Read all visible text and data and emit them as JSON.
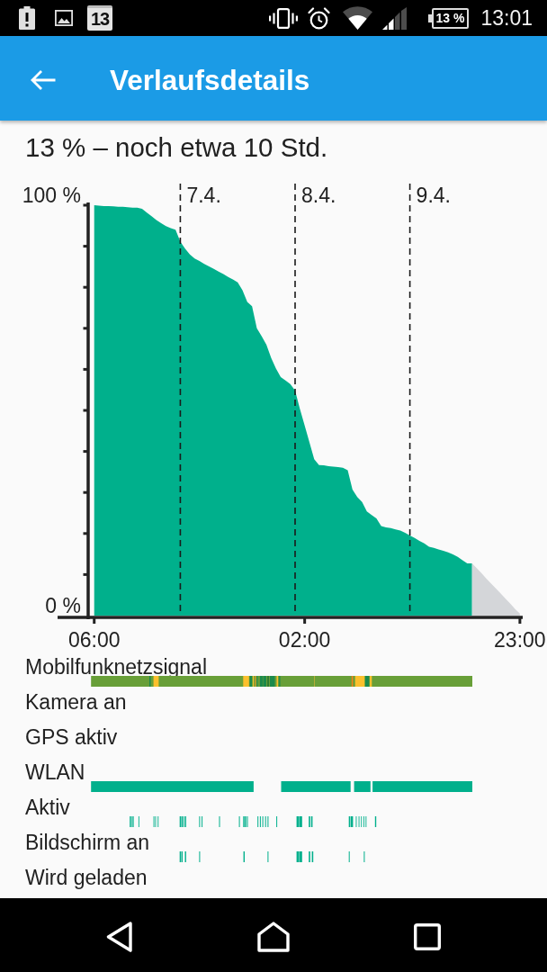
{
  "status_bar": {
    "calendar_day": "13",
    "battery": "13 %",
    "time": "13:01"
  },
  "app_bar": {
    "title": "Verlaufsdetails"
  },
  "summary": "13 % – noch etwa 10 Std.",
  "chart": {
    "day_labels": [
      "7.4.",
      "8.4.",
      "9.4."
    ],
    "chart_data": {
      "type": "area",
      "grid": true,
      "categories": [
        "06:00",
        null,
        null,
        null,
        null,
        null,
        null,
        null,
        null,
        null,
        null,
        null,
        null,
        null,
        null,
        null,
        null,
        null,
        null,
        null,
        null,
        null,
        null,
        null,
        null,
        null,
        null,
        null,
        null,
        null,
        null,
        null,
        null,
        null,
        null,
        null,
        null,
        null,
        null,
        null,
        null,
        null,
        null,
        null,
        "02:00",
        null,
        null,
        null,
        null,
        null,
        null,
        null,
        null,
        null,
        null,
        null,
        null,
        null,
        null,
        null,
        null,
        null,
        null,
        null,
        null,
        null,
        null,
        null,
        null,
        null,
        null,
        null,
        null,
        null,
        null,
        null,
        null,
        null,
        null,
        null,
        null,
        null,
        null,
        null,
        null,
        null,
        null,
        null,
        null,
        "23:00"
      ],
      "series": [
        {
          "color": "#00b08c",
          "values": [
            100.0,
            99.9,
            99.8,
            99.8,
            99.7,
            99.6,
            99.6,
            99.5,
            99.4,
            99.4,
            99.1,
            98.2,
            97.3,
            96.4,
            95.6,
            94.9,
            94.4,
            94.0,
            91.1,
            89.4,
            88.0,
            87.0,
            86.4,
            85.7,
            85.1,
            84.5,
            83.8,
            83.2,
            82.5,
            81.9,
            81.2,
            79.3,
            76.4,
            75.4,
            70.0,
            68.1,
            66.0,
            62.8,
            60.2,
            58.1,
            57.3,
            56.4,
            54.8,
            50.4,
            46.3,
            42.2,
            38.1,
            36.7,
            36.6,
            36.4,
            36.3,
            36.2,
            36.0,
            35.4,
            30.7,
            28.9,
            27.7,
            25.4,
            24.5,
            23.7,
            21.8,
            21.5,
            21.3,
            21.0,
            20.7,
            20.2,
            19.5,
            18.9,
            18.2,
            17.6,
            16.8,
            16.5,
            16.1,
            15.8,
            15.4,
            14.9,
            14.3,
            13.5,
            12.7,
            12.7,
            null,
            null,
            null,
            null,
            null,
            null,
            null,
            null,
            null,
            null
          ]
        },
        {
          "color": "#d4d6d9",
          "values": [
            null,
            null,
            null,
            null,
            null,
            null,
            null,
            null,
            null,
            null,
            null,
            null,
            null,
            null,
            null,
            null,
            null,
            null,
            null,
            null,
            null,
            null,
            null,
            null,
            null,
            null,
            null,
            null,
            null,
            null,
            null,
            null,
            null,
            null,
            null,
            null,
            null,
            null,
            null,
            null,
            null,
            null,
            null,
            null,
            null,
            null,
            null,
            null,
            null,
            null,
            null,
            null,
            null,
            null,
            null,
            null,
            null,
            null,
            null,
            null,
            null,
            null,
            null,
            null,
            null,
            null,
            null,
            null,
            null,
            null,
            null,
            null,
            null,
            null,
            null,
            null,
            null,
            null,
            null,
            12.7,
            11.5,
            10.3,
            9.0,
            7.8,
            6.6,
            5.4,
            4.1,
            2.9,
            1.6,
            0.5
          ]
        }
      ],
      "ylim": [
        0,
        100
      ],
      "yticks": [
        {
          "value": 0,
          "label": "0 %"
        },
        {
          "value": 100,
          "label": "100 %"
        }
      ]
    }
  },
  "timeline_rows": [
    {
      "label": "Mobilfunknetzsignal",
      "kind": "signal"
    },
    {
      "label": "Kamera an",
      "kind": "camera"
    },
    {
      "label": "GPS aktiv",
      "kind": "gps"
    },
    {
      "label": "WLAN",
      "kind": "wifi"
    },
    {
      "label": "Aktiv",
      "kind": "awake"
    },
    {
      "label": "Bildschirm an",
      "kind": "screen"
    },
    {
      "label": "Wird geladen",
      "kind": "charging"
    }
  ]
}
